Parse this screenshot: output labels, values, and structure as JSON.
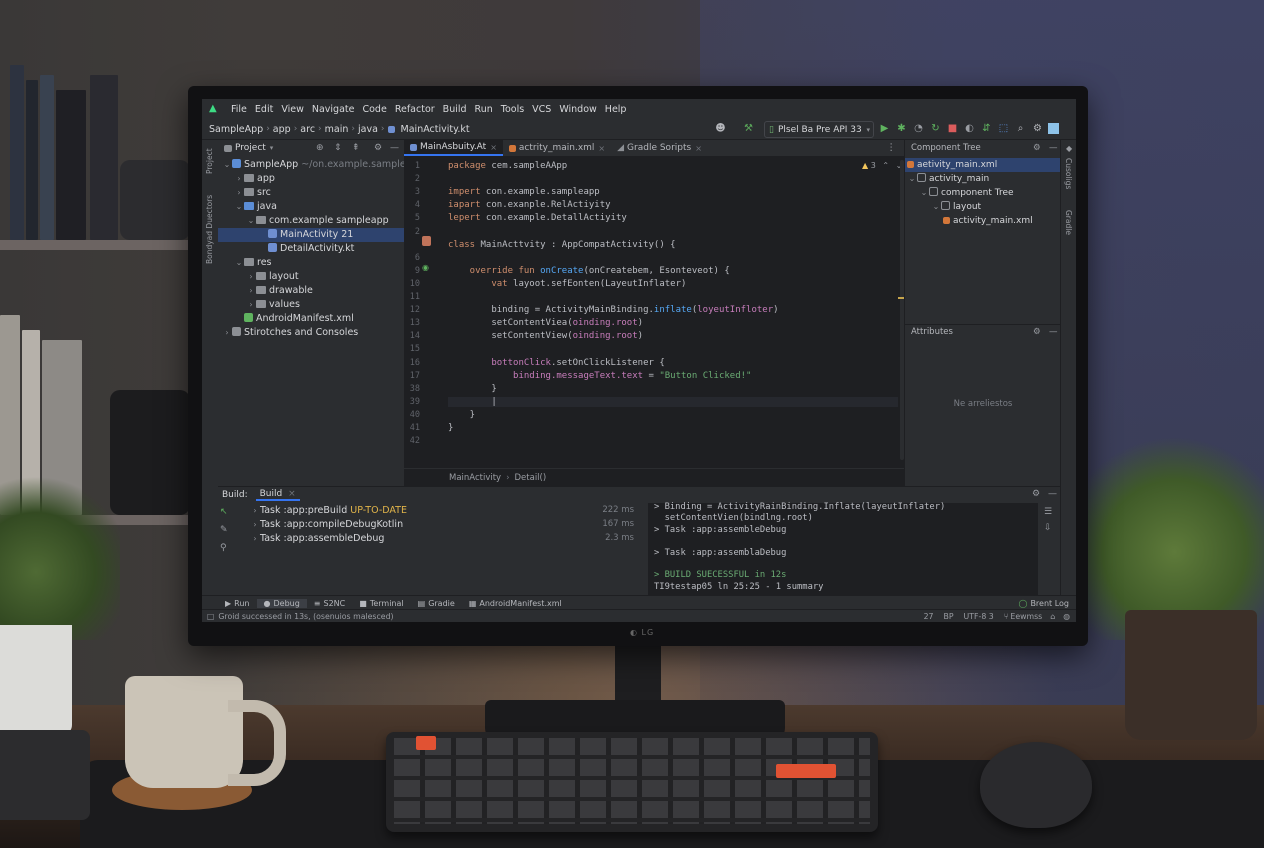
{
  "menubar": {
    "items": [
      "File",
      "Edit",
      "View",
      "Navigate",
      "Code",
      "Refactor",
      "Build",
      "Run",
      "Tools",
      "VCS",
      "Window",
      "Help"
    ]
  },
  "toolbar": {
    "breadcrumb": [
      "SampleApp",
      "app",
      "arc",
      "main",
      "java",
      "MainActivity.kt"
    ],
    "device": "Plsel Ba Pre API 33"
  },
  "left_strip": {
    "labels": [
      "Project",
      "Bondyad Duectors"
    ]
  },
  "project_panel": {
    "title": "Project",
    "tree": [
      {
        "indent": 0,
        "chev": "v",
        "icon": "module",
        "label": "SampleApp",
        "hint": " ~/on.example.sampleap"
      },
      {
        "indent": 1,
        "chev": ">",
        "icon": "folder",
        "label": "app",
        "hint": ""
      },
      {
        "indent": 1,
        "chev": ">",
        "icon": "folder",
        "label": "src",
        "hint": ""
      },
      {
        "indent": 1,
        "chev": "v",
        "icon": "folder-blue",
        "label": "java",
        "hint": ""
      },
      {
        "indent": 2,
        "chev": "v",
        "icon": "folder",
        "label": "com.example sampleapp",
        "hint": ""
      },
      {
        "indent": 3,
        "chev": "",
        "icon": "kotlin",
        "label": "MainActivity 21",
        "hint": "",
        "selected": true
      },
      {
        "indent": 3,
        "chev": "",
        "icon": "kotlin",
        "label": "DetailActivity.kt",
        "hint": ""
      },
      {
        "indent": 1,
        "chev": "v",
        "icon": "folder",
        "label": "res",
        "hint": ""
      },
      {
        "indent": 2,
        "chev": ">",
        "icon": "folder",
        "label": "layout",
        "hint": ""
      },
      {
        "indent": 2,
        "chev": ">",
        "icon": "folder",
        "label": "drawable",
        "hint": ""
      },
      {
        "indent": 2,
        "chev": ">",
        "icon": "folder",
        "label": "values",
        "hint": ""
      },
      {
        "indent": 1,
        "chev": "",
        "icon": "manifest",
        "label": "AndroidManifest.xml",
        "hint": ""
      },
      {
        "indent": 0,
        "chev": ">",
        "icon": "scratch",
        "label": "Stirotches and Consoles",
        "hint": ""
      }
    ]
  },
  "editor": {
    "tabs": [
      {
        "label": "MainAsbuity.At",
        "active": true
      },
      {
        "label": "actrity_main.xml",
        "active": false
      },
      {
        "label": "Gradle Soripts",
        "active": false
      }
    ],
    "warning": "3",
    "line_numbers": [
      "1",
      "2",
      "3",
      "4",
      "5",
      "2",
      "",
      "6",
      "9",
      "10",
      "11",
      "12",
      "13",
      "14",
      "15",
      "16",
      "17",
      "38",
      "39",
      "40",
      "41",
      "42"
    ],
    "lines": [
      [
        {
          "t": "package",
          "c": "kw"
        },
        {
          "t": " cem.sampleAApp",
          "c": ""
        }
      ],
      [],
      [
        {
          "t": "impert",
          "c": "kw"
        },
        {
          "t": " con.example.sampleapp",
          "c": ""
        }
      ],
      [
        {
          "t": "iapart",
          "c": "kw"
        },
        {
          "t": " con.exanple.RelActiyity",
          "c": ""
        }
      ],
      [
        {
          "t": "lepert",
          "c": "kw"
        },
        {
          "t": " con.example.DetallActiyity",
          "c": ""
        }
      ],
      [],
      [
        {
          "t": "class",
          "c": "kw"
        },
        {
          "t": " MainActtvity : AppCompatActivity() {",
          "c": ""
        }
      ],
      [],
      [
        {
          "t": "    override fun ",
          "c": "kw"
        },
        {
          "t": "onCreate",
          "c": "fn"
        },
        {
          "t": "(onCreatebem, Esonteveot) {",
          "c": ""
        }
      ],
      [
        {
          "t": "        vat",
          "c": "kw"
        },
        {
          "t": " layoot.sefEonten(LayeutInflater)",
          "c": ""
        }
      ],
      [],
      [
        {
          "t": "        binding = ActivityMainBinding.",
          "c": ""
        },
        {
          "t": "inflate",
          "c": "fn"
        },
        {
          "t": "(",
          "c": ""
        },
        {
          "t": "loyeutInfloter",
          "c": "prop"
        },
        {
          "t": ")",
          "c": ""
        }
      ],
      [
        {
          "t": "        setContentViea(",
          "c": ""
        },
        {
          "t": "oinding.root",
          "c": "prop"
        },
        {
          "t": ")",
          "c": ""
        }
      ],
      [
        {
          "t": "        setContentView(",
          "c": ""
        },
        {
          "t": "oinding.root",
          "c": "prop"
        },
        {
          "t": ")",
          "c": ""
        }
      ],
      [],
      [
        {
          "t": "        bottonClick",
          "c": "prop"
        },
        {
          "t": ".setOnClickListener {",
          "c": ""
        }
      ],
      [
        {
          "t": "            binding.messageText.text",
          "c": "prop"
        },
        {
          "t": " = ",
          "c": ""
        },
        {
          "t": "\"Button Clicked!\"",
          "c": "str"
        }
      ],
      [
        {
          "t": "        }",
          "c": ""
        }
      ],
      [
        {
          "t": "        |",
          "c": ""
        }
      ],
      [
        {
          "t": "    }",
          "c": ""
        }
      ],
      [
        {
          "t": "}",
          "c": ""
        }
      ],
      []
    ],
    "footer_breadcrumb": [
      "MainActivity",
      "Detail()"
    ]
  },
  "component_tree": {
    "title": "Component Tree",
    "items": [
      {
        "indent": 0,
        "label": "aetivity_main.xml",
        "selected": true
      },
      {
        "indent": 0,
        "label": "activity_main",
        "chev": "v"
      },
      {
        "indent": 1,
        "label": "component Tree",
        "chev": "v"
      },
      {
        "indent": 2,
        "label": "layout",
        "chev": "v"
      },
      {
        "indent": 3,
        "label": "activity_main.xml"
      }
    ]
  },
  "attributes": {
    "title": "Attributes",
    "empty": "Ne arreliestos"
  },
  "right_strip": {
    "labels": [
      "Cusoligs",
      "Gradle"
    ]
  },
  "build": {
    "label": "Build:",
    "tab": "Build",
    "tasks": [
      {
        "name": "Task :app:preBuild ",
        "status": "UP-TO-DATE",
        "time": "222 ms"
      },
      {
        "name": "Task :app:compileDebugKotlin",
        "status": "",
        "time": "167 ms"
      },
      {
        "name": "Task :app:assembleDebug",
        "status": "",
        "time": "2.3 ms"
      }
    ],
    "console": [
      {
        "t": "> Binding = ActivityRainBinding.Inflate(layeutInflater)",
        "c": ""
      },
      {
        "t": "  setContentVien(bindlng.root)",
        "c": ""
      },
      {
        "t": "> Task :app:assembleDebug",
        "c": ""
      },
      {
        "t": "",
        "c": ""
      },
      {
        "t": "> Task :app:assemblaDebug",
        "c": ""
      },
      {
        "t": "",
        "c": ""
      },
      {
        "t": "> BUILD SUECESSFUL in 12s",
        "c": "ok"
      },
      {
        "t": "TI9testap05 ln 25:25 - 1 summary",
        "c": ""
      }
    ]
  },
  "bottom_tabs": {
    "items": [
      {
        "icon": "▶",
        "label": "Run"
      },
      {
        "icon": "●",
        "label": "Debug",
        "active": true
      },
      {
        "icon": "≡",
        "label": "S2NC"
      },
      {
        "icon": "■",
        "label": "Terminal"
      },
      {
        "icon": "▤",
        "label": "Gradie"
      },
      {
        "icon": "▦",
        "label": "AndroidManifest.xml"
      }
    ],
    "right": "Brent Log"
  },
  "statusbar": {
    "message": "Groid successed in 13s, (osenuios malesced)",
    "position": "27",
    "indent": "BP",
    "encoding": "UTF-8 3",
    "branch": "Eewmss"
  },
  "colors": {
    "ide_bg": "#2b2d30",
    "editor_bg": "#1e1f22",
    "selection": "#2e436e",
    "accent": "#3574f0",
    "success": "#6aab73"
  }
}
